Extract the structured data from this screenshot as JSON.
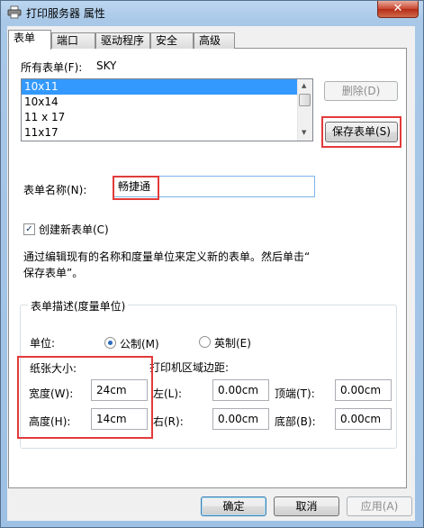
{
  "window": {
    "title": "打印服务器 属性",
    "close_label": "✕"
  },
  "tabs": [
    {
      "label": "表单"
    },
    {
      "label": "端口"
    },
    {
      "label": "驱动程序"
    },
    {
      "label": "安全"
    },
    {
      "label": "高级"
    }
  ],
  "forms": {
    "all_forms_label": "所有表单(F):",
    "server_name": "SKY",
    "list_items": [
      "10x11",
      "10x14",
      "11 x 17",
      "11x17"
    ],
    "selected_index": 0,
    "delete_button": "删除(D)",
    "save_button": "保存表单(S)",
    "form_name_label": "表单名称(N):",
    "form_name_value": "畅捷通",
    "create_new_label": "创建新表单(C)",
    "create_new_checked": true,
    "description_line1": "通过编辑现有的名称和度量单位来定义新的表单。然后单击“",
    "description_line2": "保存表单”。"
  },
  "measurements": {
    "group_title": "表单描述(度量单位)",
    "unit_label": "单位:",
    "metric_label": "公制(M)",
    "english_label": "英制(E)",
    "selected_unit": "metric",
    "paper_size_label": "纸张大小:",
    "printer_area_label": "打印机区域边距:",
    "width_label": "宽度(W):",
    "width_value": "24cm",
    "height_label": "高度(H):",
    "height_value": "14cm",
    "left_label": "左(L):",
    "left_value": "0.00cm",
    "right_label": "右(R):",
    "right_value": "0.00cm",
    "top_label": "顶端(T):",
    "top_value": "0.00cm",
    "bottom_label": "底部(B):",
    "bottom_value": "0.00cm"
  },
  "footer": {
    "ok_button": "确定",
    "cancel_button": "取消",
    "apply_button": "应用(A)"
  }
}
